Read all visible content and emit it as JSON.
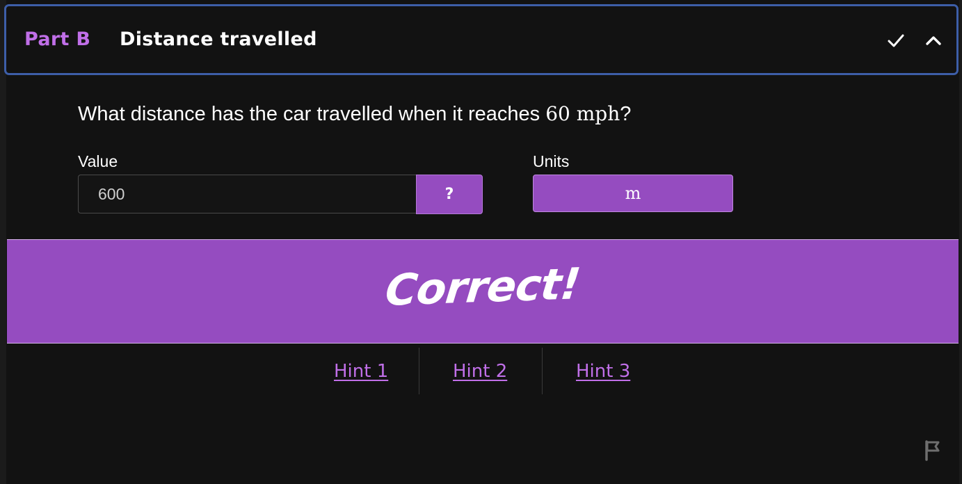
{
  "header": {
    "part_label": "Part B",
    "title": "Distance travelled",
    "icons": [
      "check-icon",
      "chevron-up-icon"
    ]
  },
  "question": {
    "text_before": "What distance has the car travelled when it reaches ",
    "math_value": "60",
    "math_unit": "mph",
    "text_after": "?"
  },
  "value_field": {
    "label": "Value",
    "value": "600",
    "help_label": "?"
  },
  "units_field": {
    "label": "Units",
    "selected": "m"
  },
  "feedback": {
    "text": "Correct!"
  },
  "hints": [
    "Hint 1",
    "Hint 2",
    "Hint 3"
  ],
  "colors": {
    "accent": "#954cc0",
    "accent_text": "#c06fe8",
    "header_border": "#3d5ea8",
    "background": "#121212"
  },
  "footer": {
    "icon": "flag-icon"
  }
}
